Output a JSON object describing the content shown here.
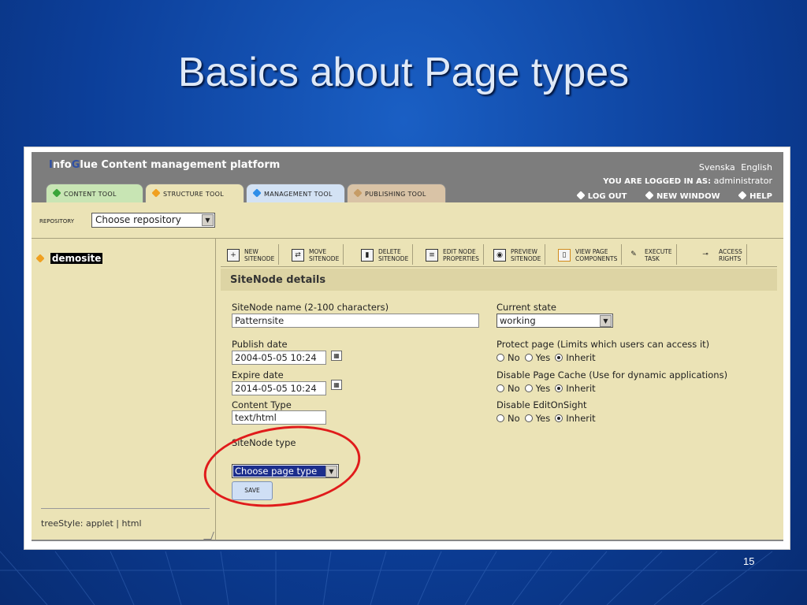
{
  "slide": {
    "title": "Basics about Page types",
    "number": "15"
  },
  "app": {
    "title_prefix_i": "I",
    "title_nfo": "nfo",
    "title_g": "G",
    "title_rest": "lue Content management platform",
    "lang_svenska": "Svenska",
    "lang_english": "English",
    "logged_in_label": "YOU ARE LOGGED IN AS:",
    "logged_in_user": "administrator",
    "links": {
      "logout": "LOG OUT",
      "new_window": "NEW WINDOW",
      "help": "HELP"
    },
    "tabs": [
      "CONTENT TOOL",
      "STRUCTURE TOOL",
      "MANAGEMENT TOOL",
      "PUBLISHING TOOL"
    ]
  },
  "repository": {
    "label": "REPOSITORY",
    "selected": "Choose repository"
  },
  "tree": {
    "root": "demosite"
  },
  "sidebar_footer": "treeStyle: applet | html",
  "toolbar": [
    {
      "line1": "NEW",
      "line2": "SITENODE"
    },
    {
      "line1": "MOVE",
      "line2": "SITENODE"
    },
    {
      "line1": "DELETE",
      "line2": "SITENODE"
    },
    {
      "line1": "EDIT NODE",
      "line2": "PROPERTIES"
    },
    {
      "line1": "PREVIEW",
      "line2": "SITENODE"
    },
    {
      "line1": "VIEW PAGE",
      "line2": "COMPONENTS"
    },
    {
      "line1": "EXECUTE",
      "line2": "TASK"
    },
    {
      "line1": "ACCESS",
      "line2": "RIGHTS"
    }
  ],
  "details": {
    "heading": "SiteNode details",
    "name_label": "SiteNode name (2-100 characters)",
    "name_value": "Patternsite",
    "publish_label": "Publish date",
    "publish_value": "2004-05-05 10:24",
    "expire_label": "Expire date",
    "expire_value": "2014-05-05 10:24",
    "content_type_label": "Content Type",
    "content_type_value": "text/html",
    "sitenode_type_label": "SiteNode type",
    "sitenode_type_value": "Choose page type",
    "save_label": "SAVE",
    "state_label": "Current state",
    "state_value": "working",
    "protect_label": "Protect page (Limits which users can access it)",
    "cache_label": "Disable Page Cache (Use for dynamic applications)",
    "eos_label": "Disable EditOnSight",
    "opt_no": "No",
    "opt_yes": "Yes",
    "opt_inherit": "Inherit"
  },
  "colors": {
    "annotation_ellipse": "#e01b1b",
    "slide_bg": "#0c3f9a"
  }
}
